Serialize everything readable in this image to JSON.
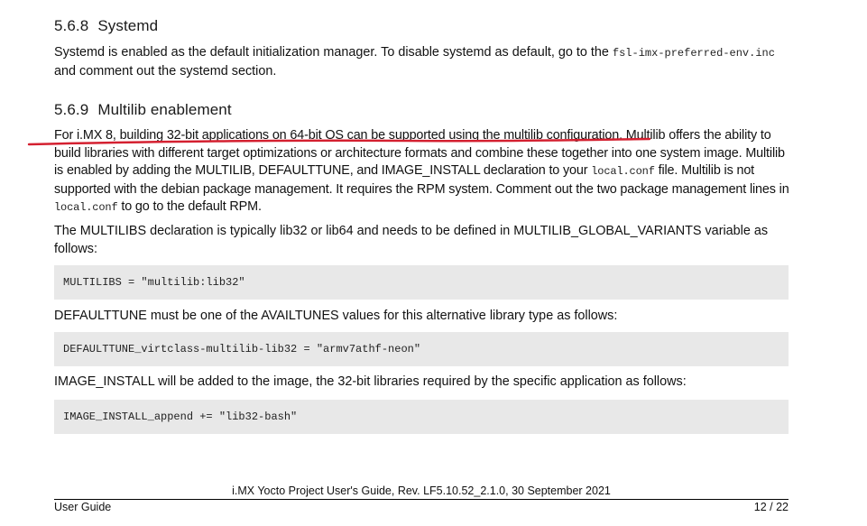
{
  "section_systemd": {
    "number": "5.6.8",
    "title": "Systemd",
    "body_before": "Systemd is enabled as the default initialization manager. To disable systemd as default, go to the ",
    "code_file": "fsl-imx-preferred-env.inc",
    "body_after": "and comment out the systemd section."
  },
  "section_multilib": {
    "number": "5.6.9",
    "title": "Multilib enablement",
    "p1_part1": "For i.MX 8, building 32-bit applications on 64-bit OS can be supported using the multilib configuration. Multilib offers the ability to build libraries with different target optimizations or architecture formats and combine these together into one system image. Multilib is enabled by adding the MULTILIB, DEFAULTTUNE, and IMAGE_INSTALL declaration to your ",
    "p1_code1": "local.conf",
    "p1_part2": " file. Multilib is not supported with the debian package management. It requires the RPM system. Comment out the two package management lines in ",
    "p1_code2": "local.conf",
    "p1_part3": " to go to the default RPM.",
    "p2": "The MULTILIBS declaration is typically lib32 or lib64 and needs to be defined in MULTILIB_GLOBAL_VARIANTS variable as follows:",
    "code1": "MULTILIBS = \"multilib:lib32\"",
    "p3": "DEFAULTTUNE must be one of the AVAILTUNES values for this alternative library type as follows:",
    "code2": "DEFAULTTUNE_virtclass-multilib-lib32 = \"armv7athf-neon\"",
    "p4": "IMAGE_INSTALL will be added to the image, the 32-bit libraries required by the specific application as follows:",
    "code3": "IMAGE_INSTALL_append += \"lib32-bash\""
  },
  "annotation": {
    "color": "#d42030"
  },
  "footer": {
    "doc_title": "i.MX Yocto Project User's Guide, Rev. LF5.10.52_2.1.0, 30 September 2021",
    "doc_type": "User Guide",
    "page": "12 / 22"
  }
}
